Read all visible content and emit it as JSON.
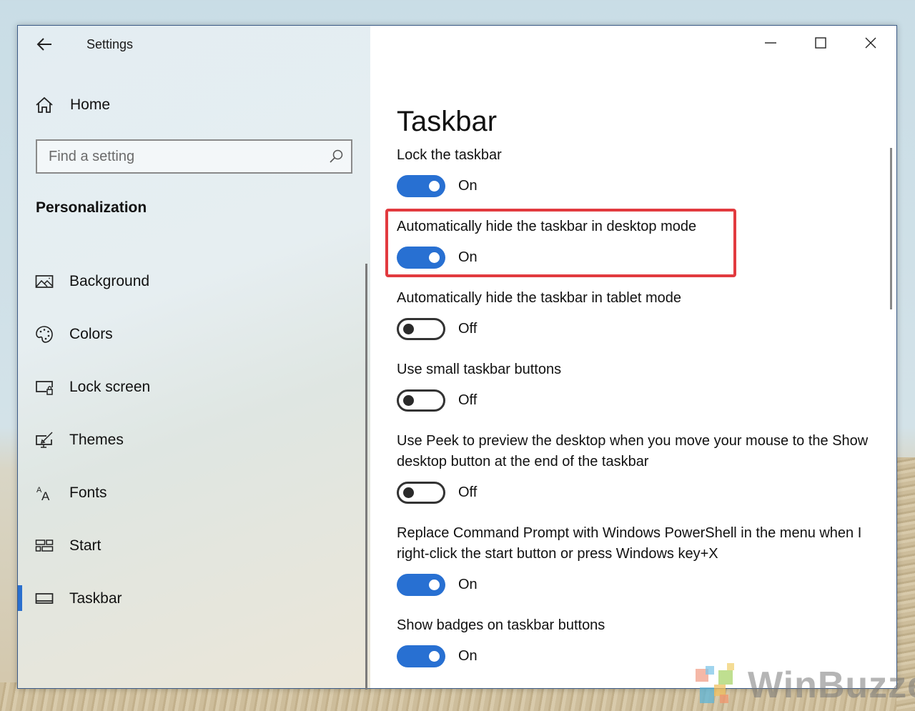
{
  "window": {
    "title": "Settings",
    "controls": {
      "minimize": "minimize-icon",
      "maximize": "maximize-icon",
      "close": "close-icon"
    }
  },
  "sidebar": {
    "back_icon": "arrow-left-icon",
    "home": {
      "label": "Home",
      "icon": "home-icon"
    },
    "search": {
      "placeholder": "Find a setting",
      "value": "",
      "icon": "search-icon"
    },
    "section_title": "Personalization",
    "items": [
      {
        "label": "Background",
        "icon": "image-icon",
        "selected": false
      },
      {
        "label": "Colors",
        "icon": "palette-icon",
        "selected": false
      },
      {
        "label": "Lock screen",
        "icon": "lock-screen-icon",
        "selected": false
      },
      {
        "label": "Themes",
        "icon": "themes-brush-icon",
        "selected": false
      },
      {
        "label": "Fonts",
        "icon": "fonts-icon",
        "selected": false
      },
      {
        "label": "Start",
        "icon": "start-tiles-icon",
        "selected": false
      },
      {
        "label": "Taskbar",
        "icon": "taskbar-icon",
        "selected": true
      }
    ]
  },
  "main": {
    "page_title": "Taskbar",
    "settings": [
      {
        "label": "Lock the taskbar",
        "state": true,
        "state_label": "On"
      },
      {
        "label": "Automatically hide the taskbar in desktop mode",
        "state": true,
        "state_label": "On",
        "highlighted": true
      },
      {
        "label": "Automatically hide the taskbar in tablet mode",
        "state": false,
        "state_label": "Off"
      },
      {
        "label": "Use small taskbar buttons",
        "state": false,
        "state_label": "Off"
      },
      {
        "label": "Use Peek to preview the desktop when you move your mouse to the Show desktop button at the end of the taskbar",
        "state": false,
        "state_label": "Off"
      },
      {
        "label": "Replace Command Prompt with Windows PowerShell in the menu when I right-click the start button or press Windows key+X",
        "state": true,
        "state_label": "On"
      },
      {
        "label": "Show badges on taskbar buttons",
        "state": true,
        "state_label": "On"
      }
    ]
  },
  "colors": {
    "accent": "#2870d2",
    "highlight_border": "#e23a3f",
    "selection_bar": "#2a6fce"
  },
  "watermark": {
    "text": "WinBuzzer"
  }
}
